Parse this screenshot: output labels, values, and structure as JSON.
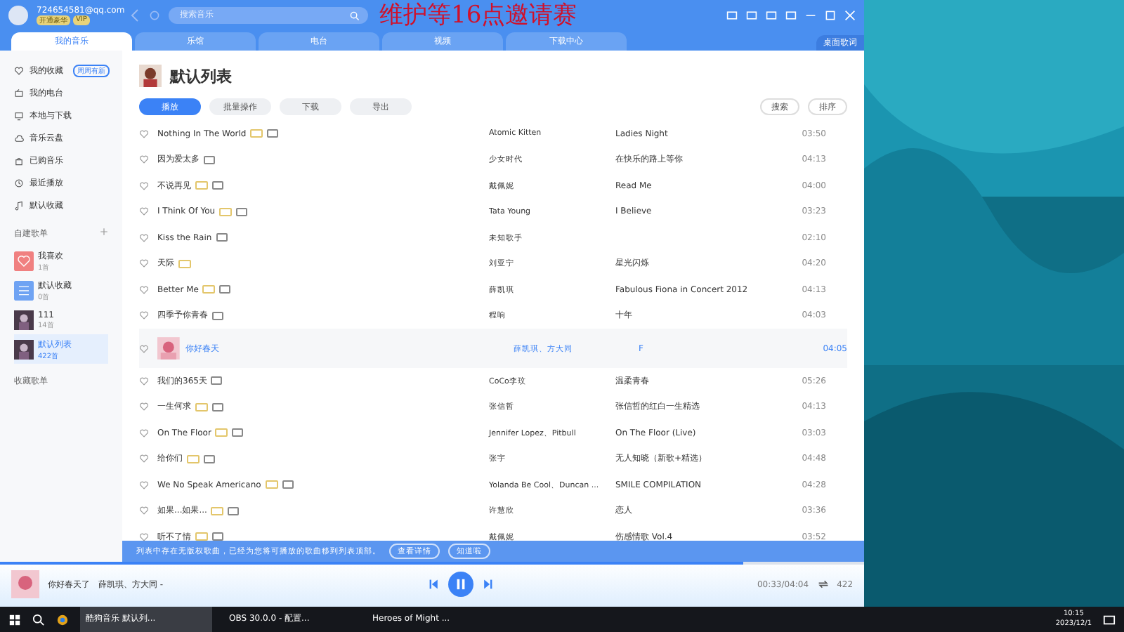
{
  "account": {
    "name": "724654581@qq.com",
    "badges": [
      "开通豪华",
      "VIP"
    ]
  },
  "search": {
    "placeholder": "搜索音乐"
  },
  "overlay_caption": "维护等16点邀请赛",
  "tabs": [
    {
      "label": "我的音乐",
      "selected": true
    },
    {
      "label": "乐馆",
      "selected": false
    },
    {
      "label": "电台",
      "selected": false
    },
    {
      "label": "视频",
      "selected": false
    },
    {
      "label": "下载中心",
      "selected": false
    }
  ],
  "side_button": "桌面歌词",
  "sidebar": {
    "items": [
      {
        "label": "我的收藏",
        "badge": "周周有新"
      },
      {
        "label": "我的电台"
      },
      {
        "label": "本地与下载"
      },
      {
        "label": "音乐云盘"
      },
      {
        "label": "已购音乐"
      },
      {
        "label": "最近播放"
      },
      {
        "label": "默认收藏"
      }
    ],
    "section": "自建歌单",
    "playlists": [
      {
        "name": "我喜欢",
        "count": "1首",
        "kind": "heart",
        "selected": false
      },
      {
        "name": "默认收藏",
        "count": "0首",
        "kind": "list",
        "selected": false
      },
      {
        "name": "111",
        "count": "14首",
        "kind": "picture",
        "selected": false
      },
      {
        "name": "默认列表",
        "count": "422首",
        "kind": "picture",
        "selected": true
      }
    ],
    "section_2": "收藏歌单"
  },
  "header": {
    "title": "默认列表",
    "buttons": [
      "播放",
      "批量操作",
      "下载",
      "导出"
    ],
    "search": "搜索",
    "sort": "排序"
  },
  "songs": [
    {
      "title": "Nothing In The World",
      "artist": "Atomic Kitten",
      "album": "Ladies Night",
      "duration": "03:50",
      "vip": true,
      "mv": true,
      "selected": false
    },
    {
      "title": "因为爱太多",
      "artist": "少女时代",
      "album": "在快乐的路上等你",
      "duration": "04:13",
      "vip": false,
      "mv": true,
      "selected": false
    },
    {
      "title": "不说再见",
      "artist": "戴佩妮",
      "album": "Read Me",
      "duration": "04:00",
      "vip": true,
      "mv": true,
      "selected": false
    },
    {
      "title": "I Think Of You",
      "artist": "Tata Young",
      "album": "I Believe",
      "duration": "03:23",
      "vip": true,
      "mv": true,
      "selected": false
    },
    {
      "title": "Kiss the Rain",
      "artist": "未知歌手",
      "duration": "02:10",
      "vip": false,
      "mv": true,
      "selected": false
    },
    {
      "title": "天际",
      "artist": "刘亚宁",
      "album": "星光闪烁",
      "duration": "04:20",
      "vip": true,
      "mv": false,
      "selected": false
    },
    {
      "title": "Better Me",
      "artist": "薛凯琪",
      "album": "Fabulous Fiona in Concert 2012",
      "duration": "04:13",
      "vip": true,
      "mv": true,
      "selected": false
    },
    {
      "title": "四季予你青春",
      "artist": "程响",
      "album": "十年",
      "duration": "04:03",
      "vip": false,
      "mv": true,
      "selected": false
    },
    {
      "title": "你好春天",
      "artist": "薛凯琪、方大同",
      "album": "F",
      "duration": "04:05",
      "vip": false,
      "mv": false,
      "selected": true
    },
    {
      "title": "我们的365天",
      "artist": "CoCo李玟",
      "album": "温柔青春",
      "duration": "05:26",
      "vip": false,
      "mv": true,
      "selected": false
    },
    {
      "title": "一生何求",
      "artist": "张信哲",
      "album": "张信哲的红白一生精选",
      "duration": "04:13",
      "vip": true,
      "mv": true,
      "selected": false
    },
    {
      "title": "On The Floor",
      "artist": "Jennifer Lopez、Pitbull",
      "album": "On The Floor (Live)",
      "duration": "03:03",
      "vip": true,
      "mv": true,
      "selected": false
    },
    {
      "title": "给你们",
      "artist": "张宇",
      "album": "无人知晓（新歌+精选）",
      "duration": "04:48",
      "vip": true,
      "mv": true,
      "selected": false
    },
    {
      "title": "We No Speak Americano",
      "artist": "Yolanda Be Cool、Duncan ...",
      "album": "SMILE COMPILATION",
      "duration": "04:28",
      "vip": true,
      "mv": true,
      "selected": false
    },
    {
      "title": "如果...如果...",
      "artist": "许慧欣",
      "album": "恋人",
      "duration": "03:36",
      "vip": true,
      "mv": true,
      "selected": false
    },
    {
      "title": "听不了情",
      "artist": "戴佩妮",
      "album": "伤感情歌 Vol.4",
      "duration": "03:52",
      "vip": true,
      "mv": true,
      "selected": false
    }
  ],
  "notice": {
    "text": "列表中存在无版权歌曲，已经为您将可播放的歌曲移到列表顶部。",
    "buttons": [
      "查看详情",
      "知道啦"
    ]
  },
  "player": {
    "title": "你好春天了",
    "artist": "薛凯琪、方大同 -",
    "time": "00:33/04:04",
    "count": "422",
    "level": 0.86
  },
  "taskbar": {
    "windows": [
      {
        "label": "酷狗音乐 默认列...",
        "selected": true
      },
      {
        "label": "OBS 30.0.0 - 配置...",
        "selected": false
      },
      {
        "label": "Heroes of Might ...",
        "selected": false
      }
    ],
    "time": "10:15",
    "date": "2023/12/1"
  }
}
